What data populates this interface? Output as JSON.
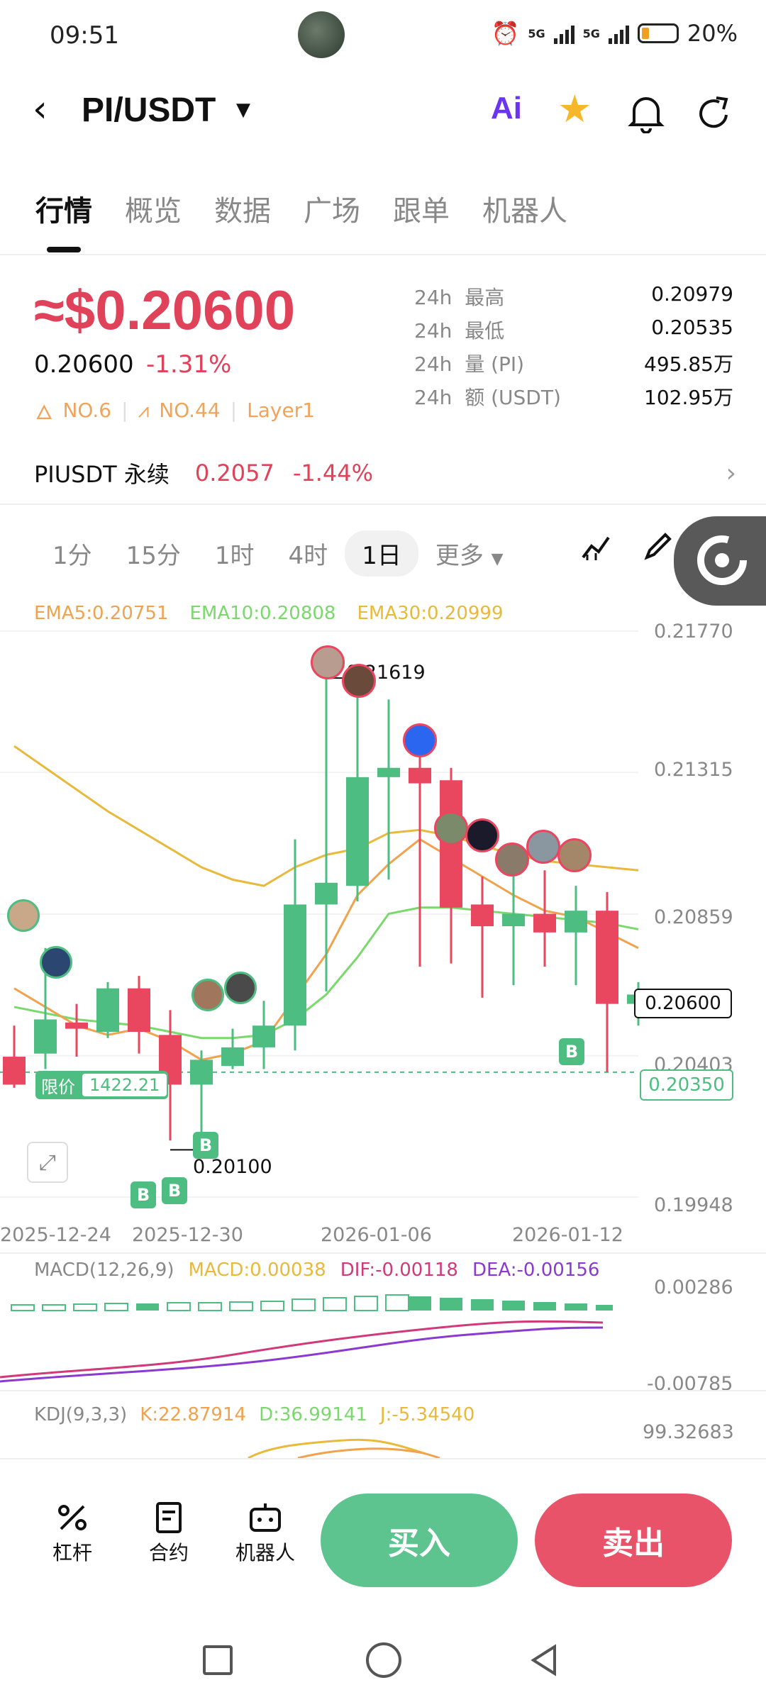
{
  "status": {
    "time": "09:51",
    "net1": "5G",
    "net2": "5G",
    "battery": "20%"
  },
  "header": {
    "pair": "PI/USDT",
    "ai_label": "Ai"
  },
  "tabs": [
    "行情",
    "概览",
    "数据",
    "广场",
    "跟单",
    "机器人"
  ],
  "price": {
    "main": "≈$0.20600",
    "last": "0.20600",
    "change": "-1.31%",
    "rank1": "NO.6",
    "rank2": "NO.44",
    "tag": "Layer1"
  },
  "stats": [
    {
      "p": "24h",
      "label": "最高",
      "value": "0.20979"
    },
    {
      "p": "24h",
      "label": "最低",
      "value": "0.20535"
    },
    {
      "p": "24h",
      "label": "量 (PI)",
      "value": "495.85万"
    },
    {
      "p": "24h",
      "label": "额 (USDT)",
      "value": "102.95万"
    }
  ],
  "perp": {
    "name": "PIUSDT 永续",
    "price": "0.2057",
    "change": "-1.44%"
  },
  "ranges": [
    "1分",
    "15分",
    "1时",
    "4时",
    "1日",
    "更多"
  ],
  "active_range": "1日",
  "ema": {
    "ema5": "EMA5:0.20751",
    "ema10": "EMA10:0.20808",
    "ema30": "EMA30:0.20999"
  },
  "y_labels": [
    "0.21770",
    "0.21315",
    "0.20859",
    "0.20403",
    "0.19948"
  ],
  "x_labels": [
    "2025-12-24",
    "2025-12-30",
    "2026-01-06",
    "2026-01-12"
  ],
  "annotations": {
    "high": "0.21619",
    "low": "0.20100",
    "current": "0.20600",
    "limit_label": "限价",
    "limit_amount": "1422.21",
    "limit_price": "0.20350",
    "buy_marker": "B"
  },
  "macd": {
    "title": "MACD(12,26,9)",
    "macd": "MACD:0.00038",
    "dif": "DIF:-0.00118",
    "dea": "DEA:-0.00156",
    "top": "0.00286",
    "bottom": "-0.00785"
  },
  "kdj": {
    "title": "KDJ(9,3,3)",
    "k": "K:22.87914",
    "d": "D:36.99141",
    "j": "J:-5.34540",
    "top": "99.32683"
  },
  "bottom": {
    "leverage": "杠杆",
    "contract": "合约",
    "robot": "机器人",
    "buy": "买入",
    "sell": "卖出"
  },
  "colors": {
    "up": "#4dbd81",
    "down": "#e9465f",
    "ema5": "#f0a24e",
    "ema10": "#7ad96b",
    "ema30": "#e8b93a"
  },
  "chart_data": {
    "type": "candlestick",
    "ylim": [
      0.19948,
      0.2177
    ],
    "candles": [
      {
        "o": 0.204,
        "h": 0.205,
        "l": 0.203,
        "c": 0.2031
      },
      {
        "o": 0.2041,
        "h": 0.2075,
        "l": 0.2036,
        "c": 0.2052
      },
      {
        "o": 0.2051,
        "h": 0.2057,
        "l": 0.204,
        "c": 0.2049
      },
      {
        "o": 0.2048,
        "h": 0.2064,
        "l": 0.2046,
        "c": 0.2062
      },
      {
        "o": 0.2062,
        "h": 0.2066,
        "l": 0.2041,
        "c": 0.2048
      },
      {
        "o": 0.2047,
        "h": 0.2055,
        "l": 0.2013,
        "c": 0.2031
      },
      {
        "o": 0.2031,
        "h": 0.2042,
        "l": 0.2015,
        "c": 0.2039
      },
      {
        "o": 0.2037,
        "h": 0.2049,
        "l": 0.2036,
        "c": 0.2043
      },
      {
        "o": 0.2043,
        "h": 0.2058,
        "l": 0.2036,
        "c": 0.205
      },
      {
        "o": 0.205,
        "h": 0.211,
        "l": 0.2042,
        "c": 0.2089
      },
      {
        "o": 0.2089,
        "h": 0.2162,
        "l": 0.2061,
        "c": 0.2096
      },
      {
        "o": 0.2095,
        "h": 0.216,
        "l": 0.209,
        "c": 0.213
      },
      {
        "o": 0.213,
        "h": 0.2155,
        "l": 0.2097,
        "c": 0.2133
      },
      {
        "o": 0.2133,
        "h": 0.214,
        "l": 0.2069,
        "c": 0.2128
      },
      {
        "o": 0.2129,
        "h": 0.2133,
        "l": 0.207,
        "c": 0.2088
      },
      {
        "o": 0.2089,
        "h": 0.2098,
        "l": 0.2059,
        "c": 0.2082
      },
      {
        "o": 0.2082,
        "h": 0.2103,
        "l": 0.2063,
        "c": 0.2086
      },
      {
        "o": 0.2086,
        "h": 0.21,
        "l": 0.2069,
        "c": 0.208
      },
      {
        "o": 0.208,
        "h": 0.2095,
        "l": 0.2063,
        "c": 0.2087
      },
      {
        "o": 0.2087,
        "h": 0.2093,
        "l": 0.2035,
        "c": 0.2057
      },
      {
        "o": 0.2057,
        "h": 0.2064,
        "l": 0.205,
        "c": 0.206
      }
    ],
    "ema5": [
      0.2062,
      0.2056,
      0.205,
      0.2047,
      0.2049,
      0.2045,
      0.2039,
      0.2041,
      0.2045,
      0.2059,
      0.2073,
      0.2092,
      0.2102,
      0.211,
      0.2104,
      0.2098,
      0.2092,
      0.2087,
      0.2085,
      0.208,
      0.2075
    ],
    "ema10": [
      0.2056,
      0.2054,
      0.2052,
      0.2051,
      0.205,
      0.2048,
      0.2046,
      0.2046,
      0.2047,
      0.2052,
      0.206,
      0.2072,
      0.2086,
      0.2088,
      0.2088,
      0.2087,
      0.2086,
      0.2085,
      0.2084,
      0.2083,
      0.2081
    ],
    "ema30": [
      0.214,
      0.2133,
      0.2126,
      0.2119,
      0.2113,
      0.2107,
      0.2101,
      0.2097,
      0.2095,
      0.2101,
      0.2105,
      0.2107,
      0.2112,
      0.2113,
      0.2111,
      0.2108,
      0.2105,
      0.2103,
      0.2102,
      0.2101,
      0.21
    ]
  }
}
